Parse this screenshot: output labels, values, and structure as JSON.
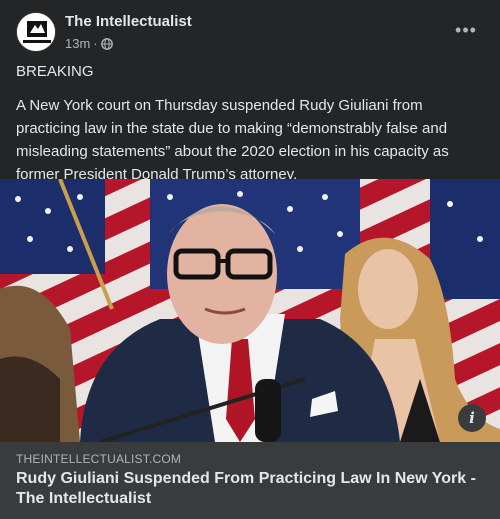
{
  "post": {
    "page_name": "The Intellectualist",
    "timestamp": "13m",
    "separator": "·",
    "audience_icon": "globe-icon",
    "more_icon": "more-options-icon",
    "more_label": "•••",
    "avatar_text": "The Intellectualist"
  },
  "content": {
    "breaking": "BREAKING",
    "body": "A New York court on Thursday suspended Rudy Giuliani from practicing law in the state due to making “demonstrably false and misleading statements” about the 2020 election in his capacity as former President Donald Trump’s attorney."
  },
  "link_preview": {
    "domain": "THEINTELLECTUALIST.COM",
    "title": "Rudy Giuliani Suspended From Practicing Law In New York - The Intellectualist",
    "info_label": "i"
  },
  "colors": {
    "background": "#242526",
    "link_box": "#3a3b3c",
    "primary_text": "#e4e6eb",
    "secondary_text": "#b0b3b8"
  }
}
